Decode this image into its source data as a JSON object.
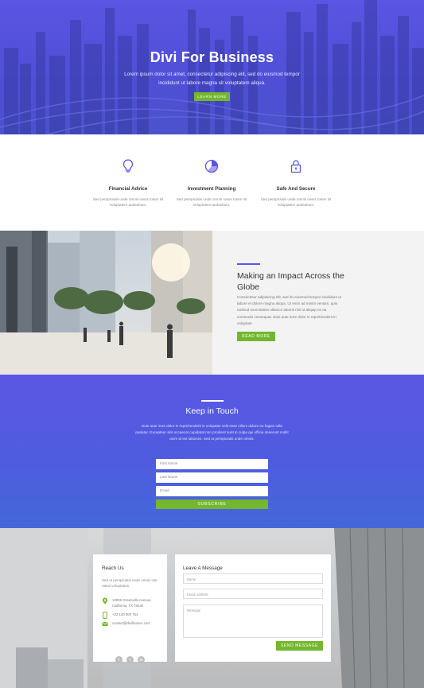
{
  "hero": {
    "title": "Divi For Business",
    "subtitle": "Lorem ipsum dolor sit amet, consectetur adipiscing elit, sed do eiusmod tempor incididunt ut labore magna sit voluptatem aliqua.",
    "button": "LEARN MORE"
  },
  "features": [
    {
      "icon": "lightbulb-icon",
      "title": "Financial Advice",
      "text": "Sed perspiciatis unde omnis natus totam sit voluptatem audantium."
    },
    {
      "icon": "pie-chart-icon",
      "title": "Investment Planning",
      "text": "Sed perspiciatis unde omnis natus totam sit voluptatem audantium."
    },
    {
      "icon": "lock-icon",
      "title": "Safe And Secure",
      "text": "Sed perspiciatis unde omnis natus totam sit voluptatem audantium."
    }
  ],
  "impact": {
    "heading": "Making an Impact Across the Globe",
    "text": "Consectetur adipisicing elit, sed do eiusmod tempor incididunt ut labore et dolore magna aliqua. Ut enim ad minim veniam, quis nostrud exercitation ullamco laboris nisi ut aliquip ex ea commodo consequat. Duis aute irure dolor in reprehenderit in voluptate.",
    "button": "READ MORE"
  },
  "touch": {
    "heading": "Keep in Touch",
    "text": "Duis aute irure dolor in reprehenderit in voluptate velit esse cillum dolore eu fugiat nulla pariatur. Excepteur sint occaecat cupidatat non proident sunt in culpa qui officia deserunt mollit anim id est laborum. Sed ut perspiciatis unde omnis.",
    "first_name_placeholder": "First Name",
    "last_name_placeholder": "Last Name",
    "email_placeholder": "Email",
    "button": "SUBSCRIBE"
  },
  "reach": {
    "heading": "Reach Us",
    "text": "Sed ut perspiciatis unde omnis iste natus voluptatem.",
    "address": "1300S Greenville Avenue, California, TX 78240",
    "phone": "+22 140 000 754",
    "email": "contact@divifinance.com",
    "social": [
      "f",
      "t",
      "in"
    ]
  },
  "message": {
    "heading": "Leave A Message",
    "name_placeholder": "Name",
    "email_placeholder": "Email Address",
    "message_placeholder": "Message",
    "button": "SEND MESSAGE"
  },
  "colors": {
    "primary": "#5a55e2",
    "accent": "#74b72e"
  }
}
